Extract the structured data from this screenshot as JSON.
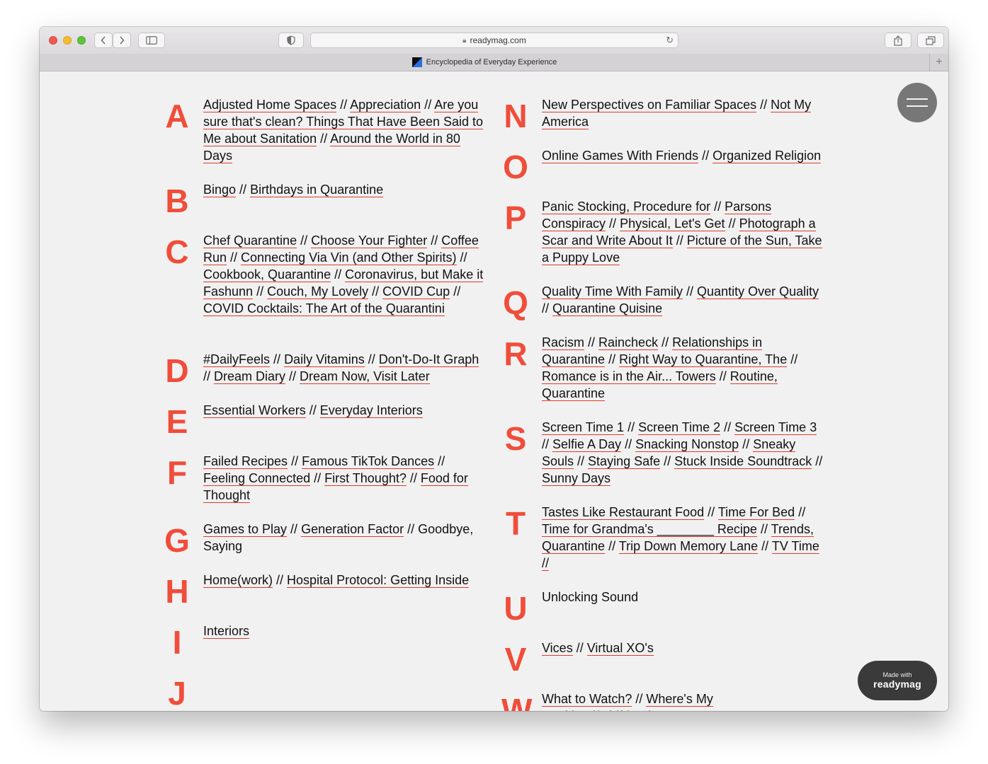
{
  "browser": {
    "url": "readymag.com",
    "tab_title": "Encyclopedia of Everyday Experience",
    "new_tab_label": "+"
  },
  "colors": {
    "letter": "#f04d3a",
    "underline": "#e23a2a",
    "menu": "#777777",
    "badge": "#3a3a3a"
  },
  "badge": {
    "line1": "Made with",
    "line2": "readymag"
  },
  "separator": " // ",
  "left": [
    {
      "letter": "A",
      "items": [
        {
          "t": "Adjusted Home Spaces",
          "l": true
        },
        {
          "t": "Appreciation",
          "l": true
        },
        {
          "t": "Are you sure that's clean? Things That Have Been Said to Me about Sanitation",
          "l": true
        },
        {
          "t": "Around the World in 80 Days",
          "l": true
        }
      ]
    },
    {
      "letter": "B",
      "items": [
        {
          "t": "Bingo",
          "l": true
        },
        {
          "t": "Birthdays in Quarantine",
          "l": true
        }
      ]
    },
    {
      "letter": "C",
      "items": [
        {
          "t": "Chef Quarantine",
          "l": true
        },
        {
          "t": "Choose Your Fighter",
          "l": true
        },
        {
          "t": "Coffee Run",
          "l": true
        },
        {
          "t": "Connecting Via Vin (and Other Spirits)",
          "l": true
        },
        {
          "t": "Cookbook, Quarantine",
          "l": true
        },
        {
          "t": "Coronavirus, but Make it Fashunn",
          "l": true
        },
        {
          "t": "Couch, My Lovely",
          "l": true
        },
        {
          "t": "COVID Cup",
          "l": true
        },
        {
          "t": "COVID Cocktails: The Art of the Quarantini",
          "l": true
        }
      ]
    },
    {
      "letter": "D",
      "items": [
        {
          "t": "#DailyFeels",
          "l": true
        },
        {
          "t": "Daily Vitamins",
          "l": true
        },
        {
          "t": "Don't-Do-It Graph",
          "l": true
        },
        {
          "t": "Dream Diary",
          "l": true
        },
        {
          "t": "Dream Now, Visit Later",
          "l": true
        }
      ]
    },
    {
      "letter": "E",
      "items": [
        {
          "t": "Essential Workers",
          "l": true
        },
        {
          "t": "Everyday Interiors",
          "l": true
        }
      ]
    },
    {
      "letter": "F",
      "items": [
        {
          "t": "Failed Recipes",
          "l": true
        },
        {
          "t": "Famous TikTok Dances",
          "l": true
        },
        {
          "t": "Feeling Connected",
          "l": true
        },
        {
          "t": "First Thought?",
          "l": true
        },
        {
          "t": "Food for Thought",
          "l": true
        }
      ]
    },
    {
      "letter": "G",
      "items": [
        {
          "t": "Games to Play",
          "l": true
        },
        {
          "t": "Generation Factor",
          "l": true
        },
        {
          "t": "Goodbye, Saying",
          "l": false
        }
      ]
    },
    {
      "letter": "H",
      "items": [
        {
          "t": "Home(work)",
          "l": true
        },
        {
          "t": "Hospital Protocol: Getting Inside",
          "l": true
        }
      ]
    },
    {
      "letter": "I",
      "items": [
        {
          "t": "Interiors",
          "l": true
        }
      ]
    },
    {
      "letter": "J",
      "items": []
    }
  ],
  "right": [
    {
      "letter": "N",
      "items": [
        {
          "t": "New Perspectives on Familiar Spaces",
          "l": true
        },
        {
          "t": "Not My America",
          "l": true
        }
      ]
    },
    {
      "letter": "O",
      "items": [
        {
          "t": "Online Games With Friends",
          "l": true
        },
        {
          "t": "Organized Religion",
          "l": true
        }
      ]
    },
    {
      "letter": "P",
      "items": [
        {
          "t": "Panic Stocking, Procedure for",
          "l": true
        },
        {
          "t": "Parsons Conspiracy",
          "l": true
        },
        {
          "t": "Physical, Let's Get",
          "l": true
        },
        {
          "t": "Photograph a Scar and Write About It",
          "l": true
        },
        {
          "t": "Picture of the Sun, Take a  Puppy Love",
          "l": true
        }
      ]
    },
    {
      "letter": "Q",
      "items": [
        {
          "t": "Quality Time With Family",
          "l": true
        },
        {
          "t": "Quantity Over Quality",
          "l": true
        },
        {
          "t": "Quarantine Quisine",
          "l": true
        }
      ]
    },
    {
      "letter": "R",
      "items": [
        {
          "t": "Racism",
          "l": true
        },
        {
          "t": "Raincheck",
          "l": true
        },
        {
          "t": "Relationships in Quarantine",
          "l": true
        },
        {
          "t": "Right Way to Quarantine, The",
          "l": true
        },
        {
          "t": "Romance is in the Air... Towers",
          "l": true
        },
        {
          "t": "Routine, Quarantine",
          "l": true
        }
      ]
    },
    {
      "letter": "S",
      "items": [
        {
          "t": "Screen Time 1",
          "l": true
        },
        {
          "t": "Screen Time 2",
          "l": true
        },
        {
          "t": "Screen Time 3",
          "l": true
        },
        {
          "t": "Selfie A Day",
          "l": true
        },
        {
          "t": "Snacking Nonstop",
          "l": true
        },
        {
          "t": "Sneaky Souls",
          "l": true
        },
        {
          "t": "Staying Safe",
          "l": true
        },
        {
          "t": "Stuck Inside Soundtrack",
          "l": true
        },
        {
          "t": "Sunny Days",
          "l": true
        }
      ]
    },
    {
      "letter": "T",
      "items": [
        {
          "t": "Tastes Like Restaurant Food",
          "l": true
        },
        {
          "t": "Time For Bed",
          "l": true
        },
        {
          "t": "Time for Grandma's ________ Recipe",
          "l": true
        },
        {
          "t": "Trends, Quarantine",
          "l": true
        },
        {
          "t": "Trip Down Memory Lane",
          "l": true
        },
        {
          "t": "TV Time //",
          "l": true
        }
      ]
    },
    {
      "letter": "U",
      "items": [
        {
          "t": "Unlocking Sound",
          "l": false
        }
      ]
    },
    {
      "letter": "V",
      "items": [
        {
          "t": "Vices",
          "l": true
        },
        {
          "t": "Virtual XO's",
          "l": true
        }
      ]
    },
    {
      "letter": "W",
      "items": [
        {
          "t": "What to Watch?",
          "l": true
        },
        {
          "t": "Where's My Boyfriend/Girlfriend?",
          "l": true
        }
      ]
    }
  ]
}
